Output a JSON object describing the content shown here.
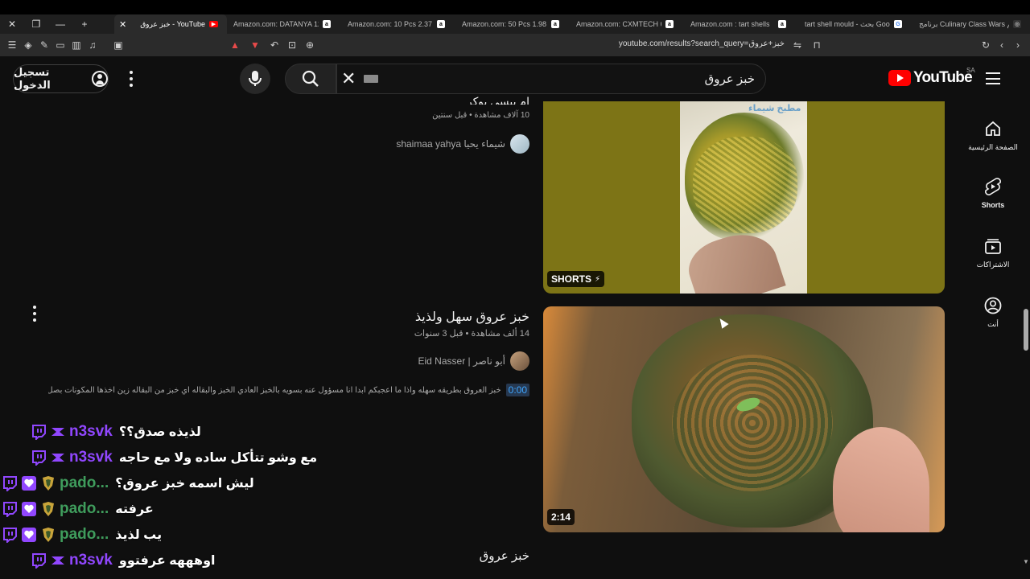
{
  "browser": {
    "tabs": [
      {
        "title": "خبز عروق - YouTube",
        "favicon": "youtube-favicon",
        "active": true
      },
      {
        "title": "Amazon.com: DATANYA 12Pac",
        "favicon": "amazon-favicon",
        "active": false
      },
      {
        "title": "Amazon.com: 10 Pcs 2.37 Inch",
        "favicon": "amazon-favicon",
        "active": false
      },
      {
        "title": "Amazon.com: 50 Pcs 1.98 Inch",
        "favicon": "amazon-favicon",
        "active": false
      },
      {
        "title": "Amazon.com: CXMTECH 6PCS",
        "favicon": "amazon-favicon",
        "active": false
      },
      {
        "title": "Amazon.com : tart shells",
        "favicon": "amazon-favicon",
        "active": false
      },
      {
        "title": "tart shell mould - بحث Google",
        "favicon": "google-favicon",
        "active": false
      },
      {
        "title": "برنامج Culinary Class Wars الم",
        "favicon": "generic-favicon",
        "active": false
      }
    ],
    "url": "youtube.com/results?search_query=خبز+عروق"
  },
  "header": {
    "signin_label": "تسجيل الدخول",
    "search_query": "خبز عروق",
    "logo_text": "YouTube",
    "country_code": "SA"
  },
  "guide": {
    "items": [
      {
        "label": "الصفحة الرئيسية",
        "icon": "home-icon"
      },
      {
        "label": "Shorts",
        "icon": "shorts-icon"
      },
      {
        "label": "الاشتراكات",
        "icon": "subscriptions-icon"
      },
      {
        "label": "أنت",
        "icon": "you-icon"
      }
    ]
  },
  "results": {
    "video1": {
      "title": "ام بيسي بوكر",
      "stats": "10 آلاف مشاهدة • قبل سنتين",
      "channel": "شيماء يحيا shaimaa yahya",
      "badge": "SHORTS",
      "thumb_caption": "مطبخ شيماء"
    },
    "video2": {
      "title": "خبز عروق سهل ولذيذ",
      "stats": "14 ألف مشاهدة • قبل 3 سنوات",
      "channel": "أبو ناصر | Eid Nasser",
      "timestamp": "0:00",
      "description": "خبز العروق بطريقه سهله واذا ما اعجبكم ابدا انا مسؤول عنه بسويه بالخبز العادي الخبز والبقاله اي خبز من البقاله زين اخذها المكونات بصل ...",
      "duration": "2:14"
    },
    "video3": {
      "title": "خبز عروق"
    }
  },
  "chat": {
    "messages": [
      {
        "user": "n3svk",
        "text": "لذيذه صدق؟؟",
        "user_color": "#9147ff",
        "badges": [
          "twitch-icon",
          "prime-icon"
        ]
      },
      {
        "user": "n3svk",
        "text": "مع وشو تتأكل ساده ولا مع حاجه",
        "user_color": "#9147ff",
        "badges": [
          "twitch-icon",
          "prime-icon"
        ]
      },
      {
        "user": "pado...",
        "text": "ليش اسمه خبز عروق؟",
        "user_color": "#3f9c5c",
        "badges": [
          "twitch-icon",
          "sub-heart-icon",
          "crest-icon"
        ]
      },
      {
        "user": "pado...",
        "text": "عرفته",
        "user_color": "#3f9c5c",
        "badges": [
          "twitch-icon",
          "sub-heart-icon",
          "crest-icon"
        ]
      },
      {
        "user": "pado...",
        "text": "يب لذيذ",
        "user_color": "#3f9c5c",
        "badges": [
          "twitch-icon",
          "sub-heart-icon",
          "crest-icon"
        ]
      },
      {
        "user": "n3svk",
        "text": "اوهههه عرفتوو",
        "user_color": "#9147ff",
        "badges": [
          "twitch-icon",
          "prime-icon"
        ]
      }
    ]
  },
  "colors": {
    "accent": "#ff0000",
    "link": "#3ea6ff",
    "background": "#0f0f0f"
  }
}
